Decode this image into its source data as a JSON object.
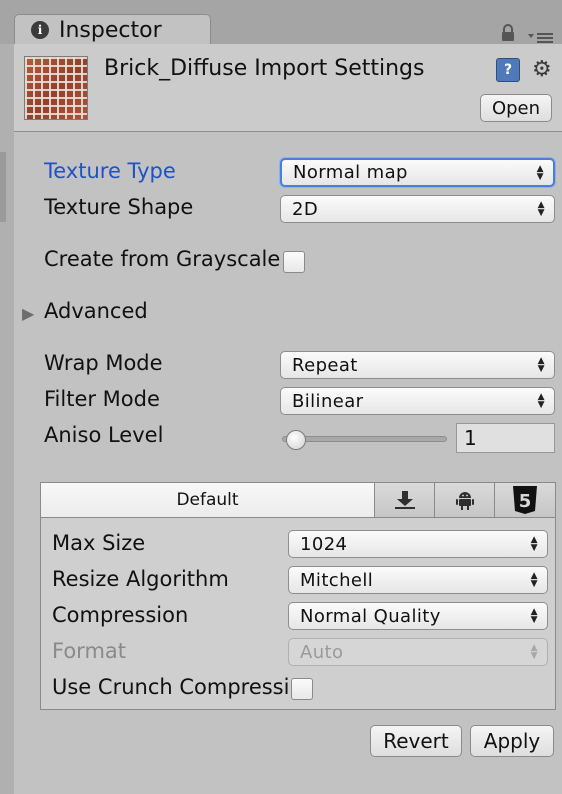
{
  "window": {
    "tab_title": "Inspector",
    "tab_icon_glyph": "i"
  },
  "header": {
    "title": "Brick_Diffuse Import Settings",
    "help_glyph": "?",
    "open_label": "Open"
  },
  "settings": {
    "texture_type": {
      "label": "Texture Type",
      "value": "Normal map"
    },
    "texture_shape": {
      "label": "Texture Shape",
      "value": "2D"
    },
    "create_from_grayscale": {
      "label": "Create from Grayscale",
      "checked": false
    },
    "advanced": {
      "label": "Advanced",
      "expanded": false
    },
    "wrap_mode": {
      "label": "Wrap Mode",
      "value": "Repeat"
    },
    "filter_mode": {
      "label": "Filter Mode",
      "value": "Bilinear"
    },
    "aniso_level": {
      "label": "Aniso Level",
      "value": "1",
      "slider_fraction": 0.0
    }
  },
  "platform": {
    "tabs": [
      {
        "label": "Default",
        "icon": "default-tab",
        "selected": true
      },
      {
        "label": "",
        "icon": "download-icon"
      },
      {
        "label": "",
        "icon": "android-icon"
      },
      {
        "label": "",
        "icon": "html5-icon",
        "glyph": "5"
      }
    ],
    "max_size": {
      "label": "Max Size",
      "value": "1024"
    },
    "resize_algorithm": {
      "label": "Resize Algorithm",
      "value": "Mitchell"
    },
    "compression": {
      "label": "Compression",
      "value": "Normal Quality"
    },
    "format": {
      "label": "Format",
      "value": "Auto",
      "disabled": true
    },
    "use_crunch": {
      "label": "Use Crunch Compression",
      "checked": false
    }
  },
  "footer": {
    "revert_label": "Revert",
    "apply_label": "Apply"
  },
  "colors": {
    "focus_label": "#1f52c4",
    "panel_bg": "#c2c2c2",
    "focus_border": "#4f7cd6"
  }
}
